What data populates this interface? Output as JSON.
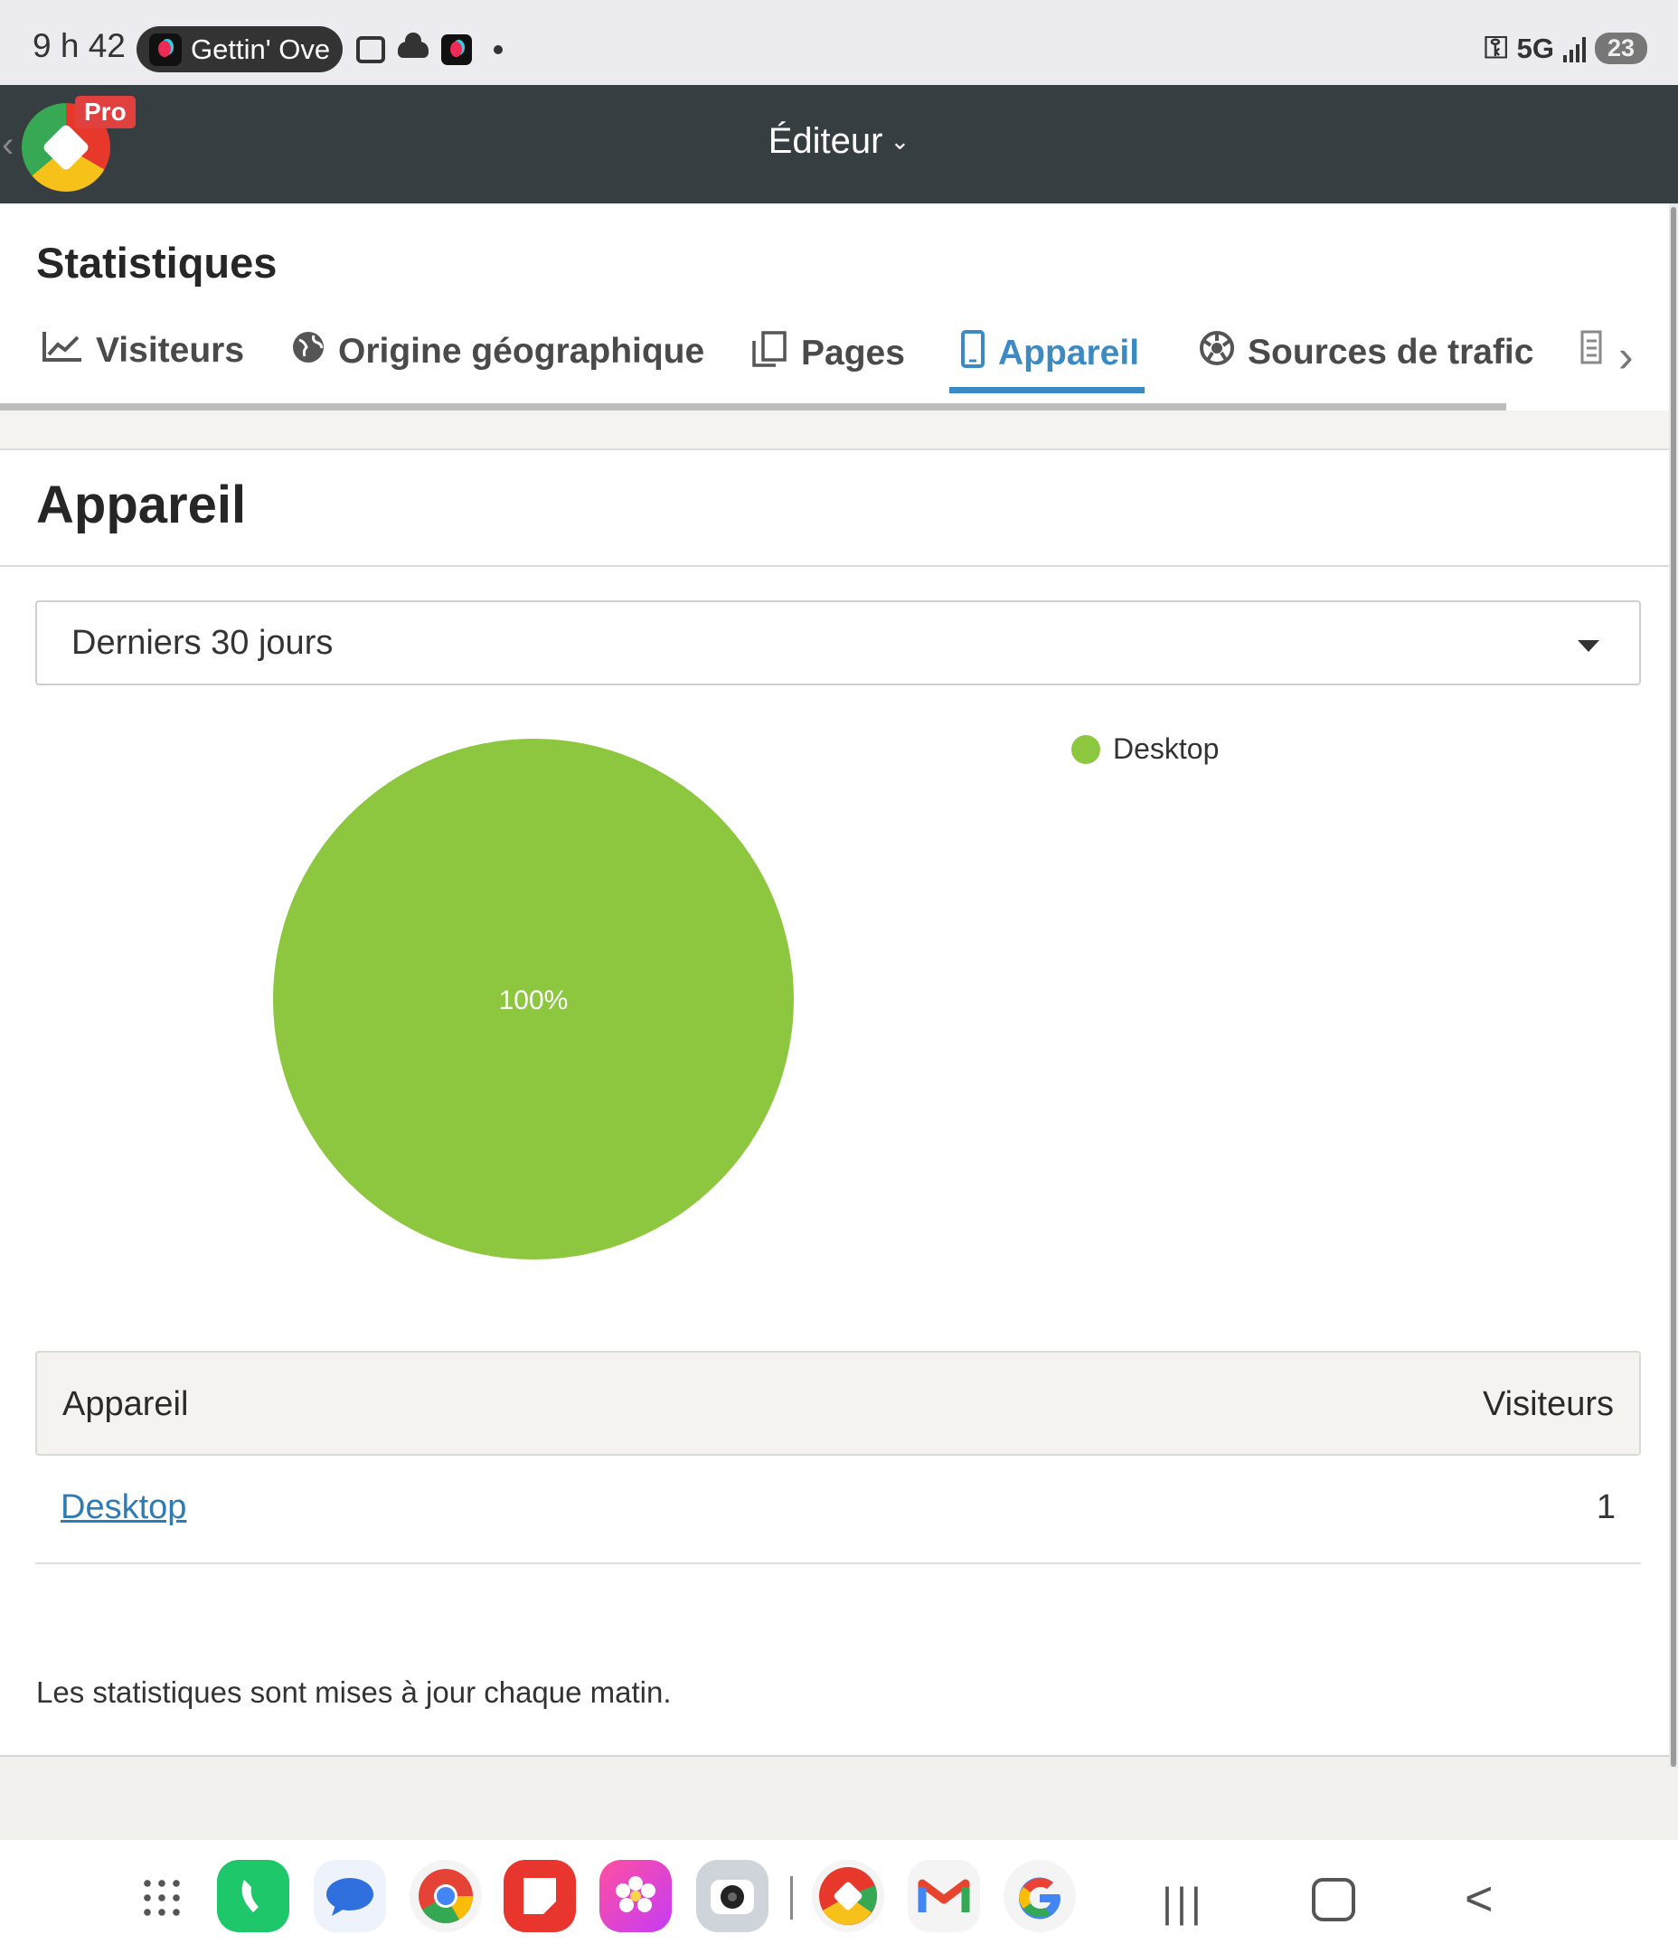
{
  "status_bar": {
    "time": "9 h 42",
    "media_pill": "Gettin' Ove",
    "network": "5G",
    "battery": "23"
  },
  "app_bar": {
    "badge": "Pro",
    "title": "Éditeur"
  },
  "page": {
    "title": "Statistiques",
    "tabs": [
      {
        "label": "Visiteurs",
        "icon": "chart-line-icon",
        "active": false
      },
      {
        "label": "Origine géographique",
        "icon": "globe-icon",
        "active": false
      },
      {
        "label": "Pages",
        "icon": "pages-icon",
        "active": false
      },
      {
        "label": "Appareil",
        "icon": "mobile-icon",
        "active": true
      },
      {
        "label": "Sources de trafic",
        "icon": "traffic-source-icon",
        "active": false
      }
    ],
    "section_title": "Appareil",
    "period_select": {
      "value": "Derniers 30 jours"
    },
    "footnote": "Les statistiques sont mises à jour chaque matin."
  },
  "chart_data": {
    "type": "pie",
    "slices": [
      {
        "label": "Desktop",
        "value": 100,
        "display": "100%",
        "color": "#8dc63f"
      }
    ],
    "legend": [
      {
        "label": "Desktop",
        "color": "#8dc63f"
      }
    ],
    "legend_position": "top-right"
  },
  "table": {
    "headers": [
      "Appareil",
      "Visiteurs"
    ],
    "rows": [
      {
        "device": "Desktop",
        "visitors": "1"
      }
    ]
  },
  "colors": {
    "accent": "#3b8ac4",
    "header_bg": "#373e42",
    "desktop_slice": "#8dc63f",
    "link": "#2e7bb5"
  },
  "nav_bar": {
    "dock_apps": [
      "apps-grid-icon",
      "phone-app-icon",
      "messages-app-icon",
      "chrome-app-icon",
      "notes-app-icon",
      "gallery-app-icon",
      "camera-app-icon",
      "site-builder-app-icon",
      "gmail-app-icon",
      "google-app-icon"
    ]
  }
}
